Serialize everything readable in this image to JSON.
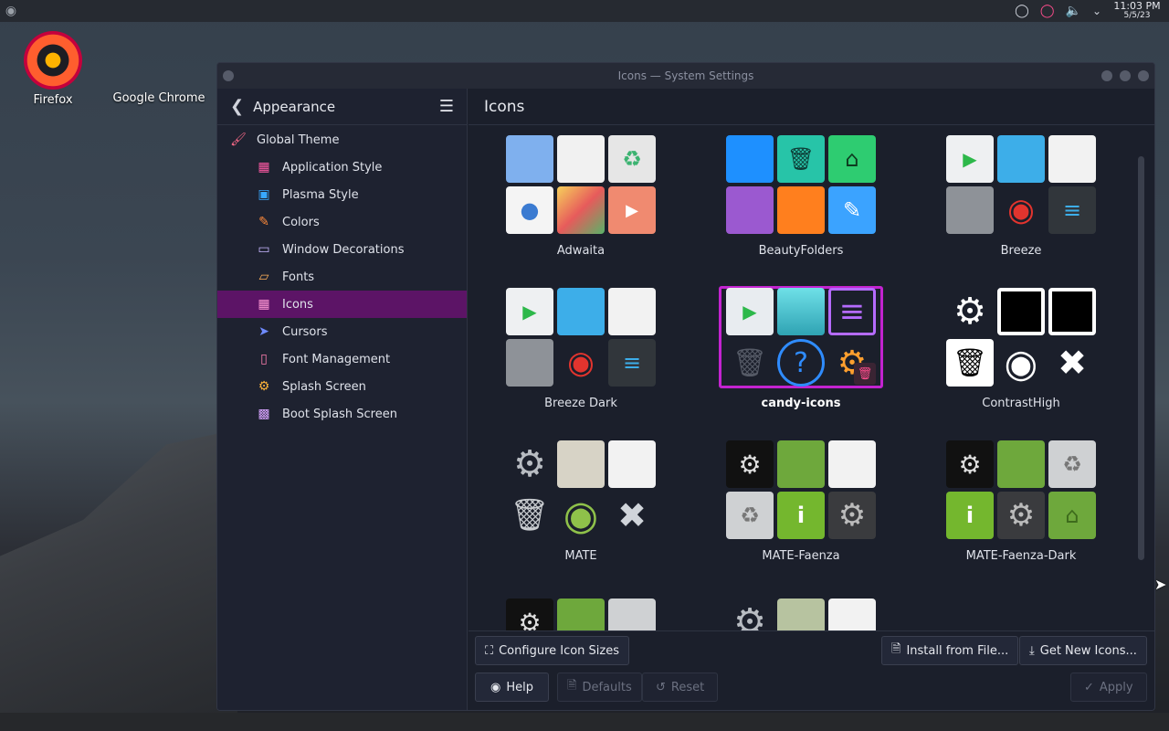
{
  "desktop": {
    "icons": [
      {
        "label": "Firefox"
      },
      {
        "label": "Google Chrome"
      }
    ]
  },
  "panel": {
    "time": "11:03 PM",
    "date": "5/5/23"
  },
  "window": {
    "title": "Icons — System Settings"
  },
  "sidebar": {
    "header": "Appearance",
    "items": [
      {
        "label": "Global Theme",
        "icon": "brush-icon",
        "level": "top"
      },
      {
        "label": "Application Style",
        "icon": "app-style-icon",
        "level": "sub"
      },
      {
        "label": "Plasma Style",
        "icon": "plasma-style-icon",
        "level": "sub"
      },
      {
        "label": "Colors",
        "icon": "colors-icon",
        "level": "sub"
      },
      {
        "label": "Window Decorations",
        "icon": "window-decorations-icon",
        "level": "sub"
      },
      {
        "label": "Fonts",
        "icon": "fonts-icon",
        "level": "sub"
      },
      {
        "label": "Icons",
        "icon": "icons-icon",
        "level": "sub",
        "active": true
      },
      {
        "label": "Cursors",
        "icon": "cursor-icon",
        "level": "sub"
      },
      {
        "label": "Font Management",
        "icon": "font-management-icon",
        "level": "sub"
      },
      {
        "label": "Splash Screen",
        "icon": "splash-screen-icon",
        "level": "sub"
      },
      {
        "label": "Boot Splash Screen",
        "icon": "boot-splash-icon",
        "level": "sub"
      }
    ]
  },
  "main": {
    "title": "Icons",
    "themes": [
      {
        "name": "Adwaita"
      },
      {
        "name": "BeautyFolders"
      },
      {
        "name": "Breeze"
      },
      {
        "name": "Breeze Dark"
      },
      {
        "name": "candy-icons",
        "selected": true
      },
      {
        "name": "ContrastHigh"
      },
      {
        "name": "MATE"
      },
      {
        "name": "MATE-Faenza"
      },
      {
        "name": "MATE-Faenza-Dark"
      }
    ]
  },
  "footer": {
    "configure_sizes": "Configure Icon Sizes",
    "install_from_file": "Install from File...",
    "get_new_icons": "Get New Icons...",
    "help": "Help",
    "defaults": "Defaults",
    "reset": "Reset",
    "apply": "Apply"
  },
  "colors": {
    "accent": "#c323d0",
    "active_item": "#5c1466"
  }
}
